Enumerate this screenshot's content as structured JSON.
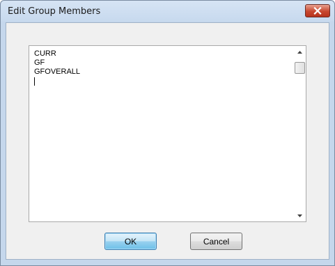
{
  "window": {
    "title": "Edit Group Members",
    "close_icon": "close-icon"
  },
  "members_text": {
    "lines": [
      "CURR",
      "GF",
      "GFOVERALL"
    ]
  },
  "buttons": {
    "ok_label": "OK",
    "cancel_label": "Cancel"
  },
  "colors": {
    "close_button": "#c7472f",
    "default_button": "#6cc0e8",
    "frame": "#c5d7ec"
  }
}
